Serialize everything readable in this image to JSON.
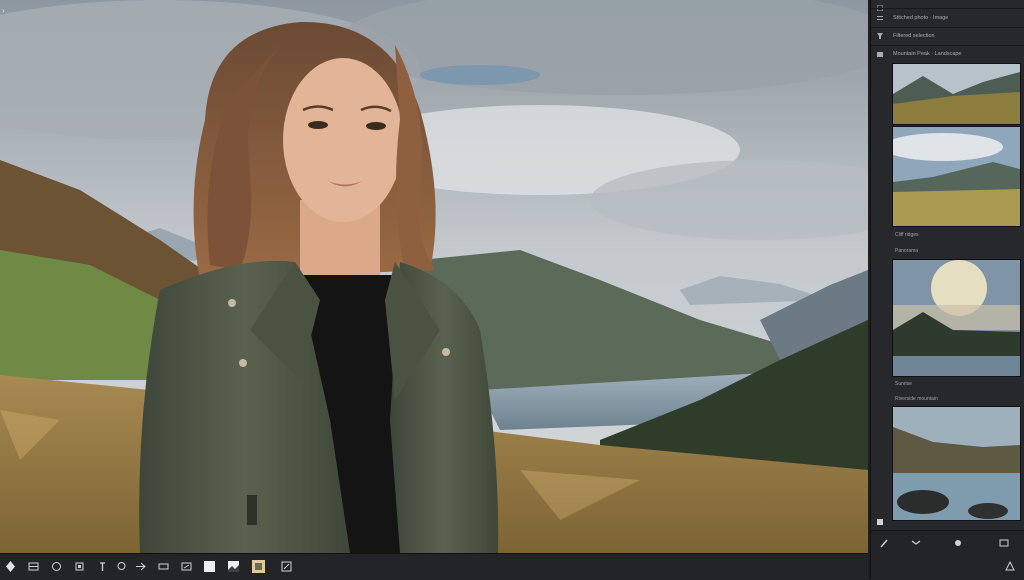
{
  "panel": {
    "header_icon": "expand-icon",
    "rows": [
      {
        "label": "Stitched photo · Image"
      },
      {
        "label": "Filtered selection"
      },
      {
        "label": "Mountain Peak · Landscape"
      }
    ],
    "section_labels": [
      {
        "label": "Cliff ridges"
      },
      {
        "label": "Panorama"
      },
      {
        "label": "Sunrise"
      },
      {
        "label": "Riverside mountain"
      }
    ],
    "thumbnails": [
      {
        "name": "mountain-valley"
      },
      {
        "name": "green-meadow-peaks"
      },
      {
        "name": "sunburst-lake"
      },
      {
        "name": "rocky-river"
      }
    ],
    "bottom_icons": [
      "brush-icon",
      "adjust-icon",
      "mask-icon",
      "grid-icon"
    ],
    "warning_icon": "warning-triangle-icon"
  },
  "toolbar": {
    "tools": [
      "move-icon",
      "crop-icon",
      "radial-icon",
      "filter-icon",
      "text-tool-icon",
      "lasso-icon",
      "transform-icon",
      "heal-icon",
      "brush-icon",
      "square-icon",
      "white-square-icon",
      "landscape-thumb-icon",
      "portrait-thumb-icon",
      "export-icon"
    ]
  },
  "canvas": {
    "description_icon": "photo-canvas"
  },
  "colors": {
    "panel_bg": "#26282b",
    "toolbar_bg": "#232427",
    "jacket": "#4e5744",
    "grass": "#b89458"
  }
}
